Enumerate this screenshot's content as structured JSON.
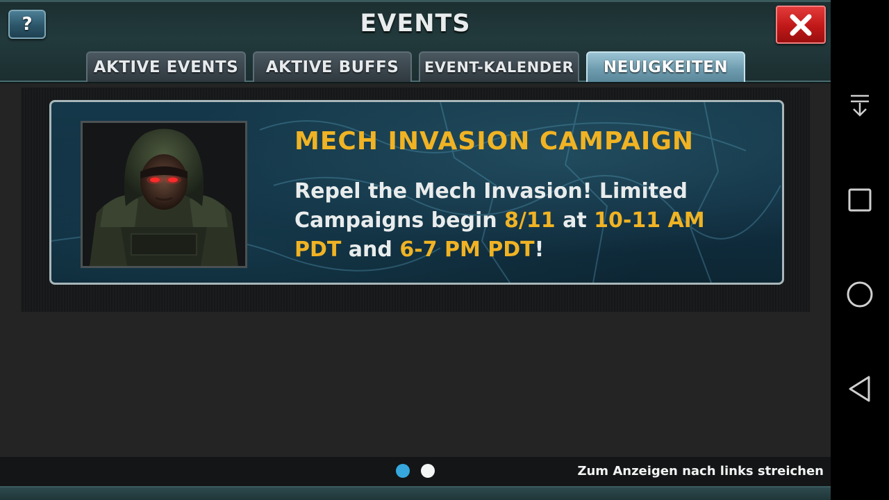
{
  "header": {
    "title": "EVENTS",
    "help_label": "?",
    "close_icon": "close-x-icon"
  },
  "tabs": [
    {
      "label": "AKTIVE EVENTS",
      "active": false
    },
    {
      "label": "AKTIVE BUFFS",
      "active": false
    },
    {
      "label": "EVENT-KALENDER",
      "active": false
    },
    {
      "label": "NEUIGKEITEN",
      "active": true
    }
  ],
  "event_card": {
    "title": "MECH INVASION CAMPAIGN",
    "text_1": "Repel the Mech Invasion! Limited Campaigns begin ",
    "date": "8/11",
    "text_2": " at ",
    "time_1": "10-11 AM PDT",
    "text_3": " and ",
    "time_2": "6-7 PM PDT",
    "text_4": "!",
    "portrait": "hooded-soldier-portrait"
  },
  "footer": {
    "pager_total": 2,
    "pager_current": 1,
    "swipe_hint": "Zum Anzeigen nach links streichen"
  },
  "navbar": {
    "icons": [
      "notification-pull-icon",
      "recents-icon",
      "home-icon",
      "back-icon"
    ]
  },
  "colors": {
    "accent_gold": "#f0b324",
    "close_red": "#c01818",
    "active_tab": "#6f9db0",
    "pager_active": "#36a8de"
  }
}
